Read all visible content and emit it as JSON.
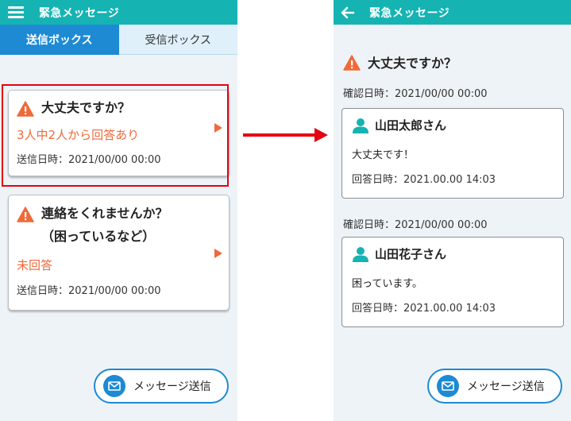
{
  "left": {
    "header_title": "緊急メッセージ",
    "tabs": [
      {
        "label": "送信ボックス",
        "active": true
      },
      {
        "label": "受信ボックス",
        "active": false
      }
    ],
    "messages": [
      {
        "title_lines": [
          "大丈夫ですか？"
        ],
        "status": "3人中2人から回答あり",
        "sent_at": "送信日時：2021/00/00 00:00",
        "highlighted": true
      },
      {
        "title_lines": [
          "連絡をくれませんか？",
          "（困っているなど）"
        ],
        "status": "未回答",
        "sent_at": "送信日時：2021/00/00 00:00",
        "highlighted": false
      }
    ],
    "send_button": "メッセージ送信"
  },
  "right": {
    "header_title": "緊急メッセージ",
    "message_title": "大丈夫ですか？",
    "replies": [
      {
        "confirmed_at": "確認日時：2021/00/00 00:00",
        "name": "山田太郎さん",
        "message": "大丈夫です！",
        "replied_at": "回答日時：2021.00.00 14:03"
      },
      {
        "confirmed_at": "確認日時：2021/00/00 00:00",
        "name": "山田花子さん",
        "message": "困っています。",
        "replied_at": "回答日時：2021.00.00 14:03"
      }
    ],
    "send_button": "メッセージ送信"
  },
  "colors": {
    "header": "#16b3b3",
    "tab_active": "#1d8ad3",
    "tab_inactive": "#dff0fb",
    "warning": "#ef6a3a",
    "highlight": "#e60012",
    "background": "#eef3f7"
  },
  "icons": [
    "hamburger-menu-icon",
    "back-arrow-icon",
    "warning-icon",
    "play-icon",
    "mail-icon",
    "person-icon",
    "flow-arrow-icon"
  ]
}
